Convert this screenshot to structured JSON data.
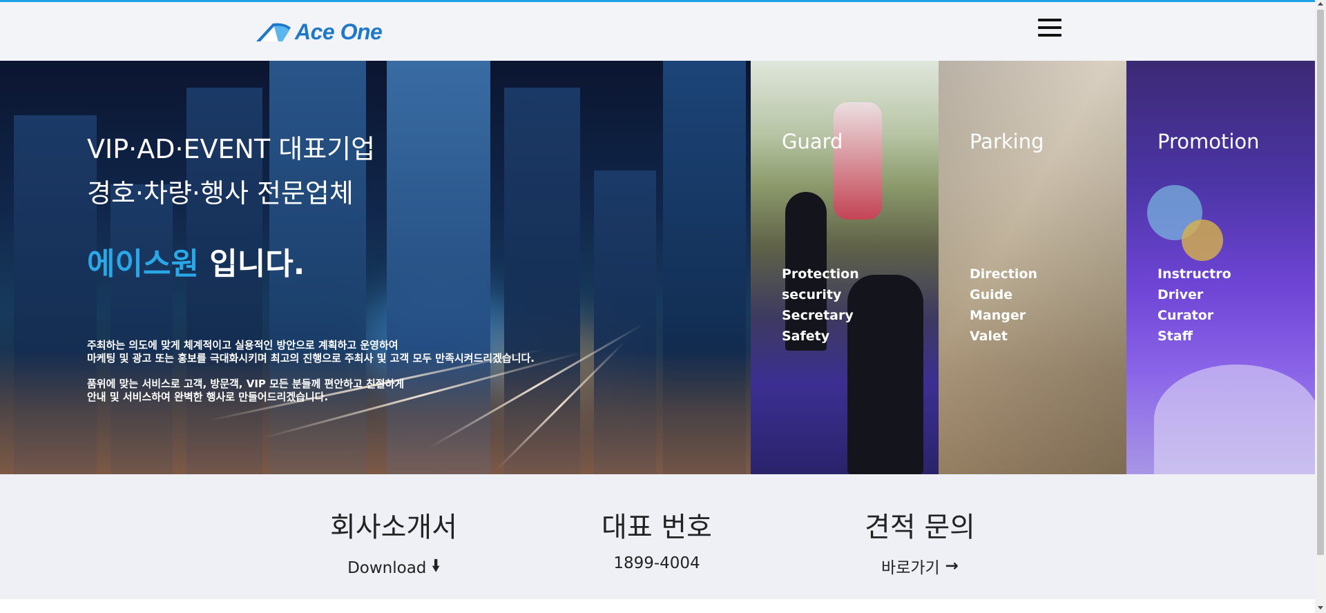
{
  "header": {
    "logo_text": "Ace One",
    "menu_icon": "hamburger-menu-icon"
  },
  "hero": {
    "title_line1": "VIP·AD·EVENT 대표기업",
    "title_line2": "경호·차량·행사 전문업체",
    "brand_name": "에이스원",
    "brand_suffix": " 입니다.",
    "desc": [
      "주최하는 의도에 맞게 체계적이고 실용적인 방안으로 계획하고 운영하여",
      "마케팅 및 광고 또는 홍보를 극대화시키며 최고의 진행으로 주최사 및 고객 모두 만족시켜드리겠습니다.",
      "품위에 맞는 서비스로 고객, 방문객, VIP 모든 분들께 편안하고 친절하게",
      "안내 및 서비스하여 완벽한 행사로 만들어드리겠습니다."
    ]
  },
  "services": [
    {
      "title": "Guard",
      "items": [
        "Protection",
        "security",
        "Secretary",
        "Safety"
      ]
    },
    {
      "title": "Parking",
      "items": [
        "Direction",
        "Guide",
        "Manger",
        "Valet"
      ]
    },
    {
      "title": "Promotion",
      "items": [
        "Instructro",
        "Driver",
        "Curator",
        "Staff"
      ]
    }
  ],
  "info": [
    {
      "title": "회사소개서",
      "sub": "Download",
      "icon": "arrow-down-icon"
    },
    {
      "title": "대표 번호",
      "sub": "1899-4004"
    },
    {
      "title": "견적 문의",
      "sub": "바로가기",
      "icon": "arrow-right-icon"
    }
  ],
  "colors": {
    "accent": "#1da1e6",
    "brand_text": "#2aa7e6",
    "logo": "#1f78c8"
  }
}
